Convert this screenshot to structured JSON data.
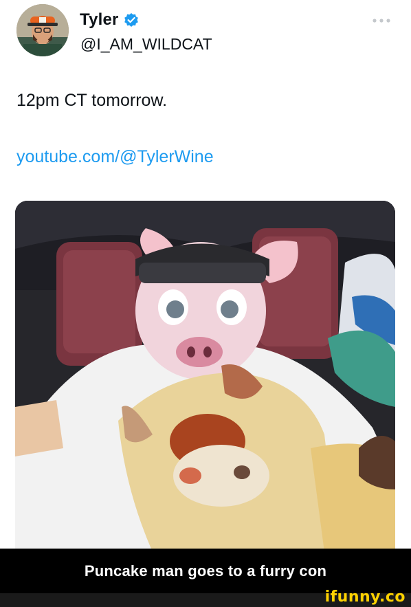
{
  "tweet": {
    "display_name": "Tyler",
    "handle": "@I_AM_WILDCAT",
    "verified": true,
    "text": "12pm CT tomorrow.",
    "link": "youtube.com/@TylerWine",
    "avatar_icon": "user-avatar-photo",
    "more_icon": "more-options-icon"
  },
  "media": {
    "description_icon": "furry-costume-photo"
  },
  "meme": {
    "caption": "Puncake man goes to a furry con",
    "watermark": "ifunny.co"
  },
  "colors": {
    "link": "#1d9bf0",
    "verified": "#1d9bf0",
    "caption_bg": "#000000",
    "watermark": "#ffd200"
  }
}
